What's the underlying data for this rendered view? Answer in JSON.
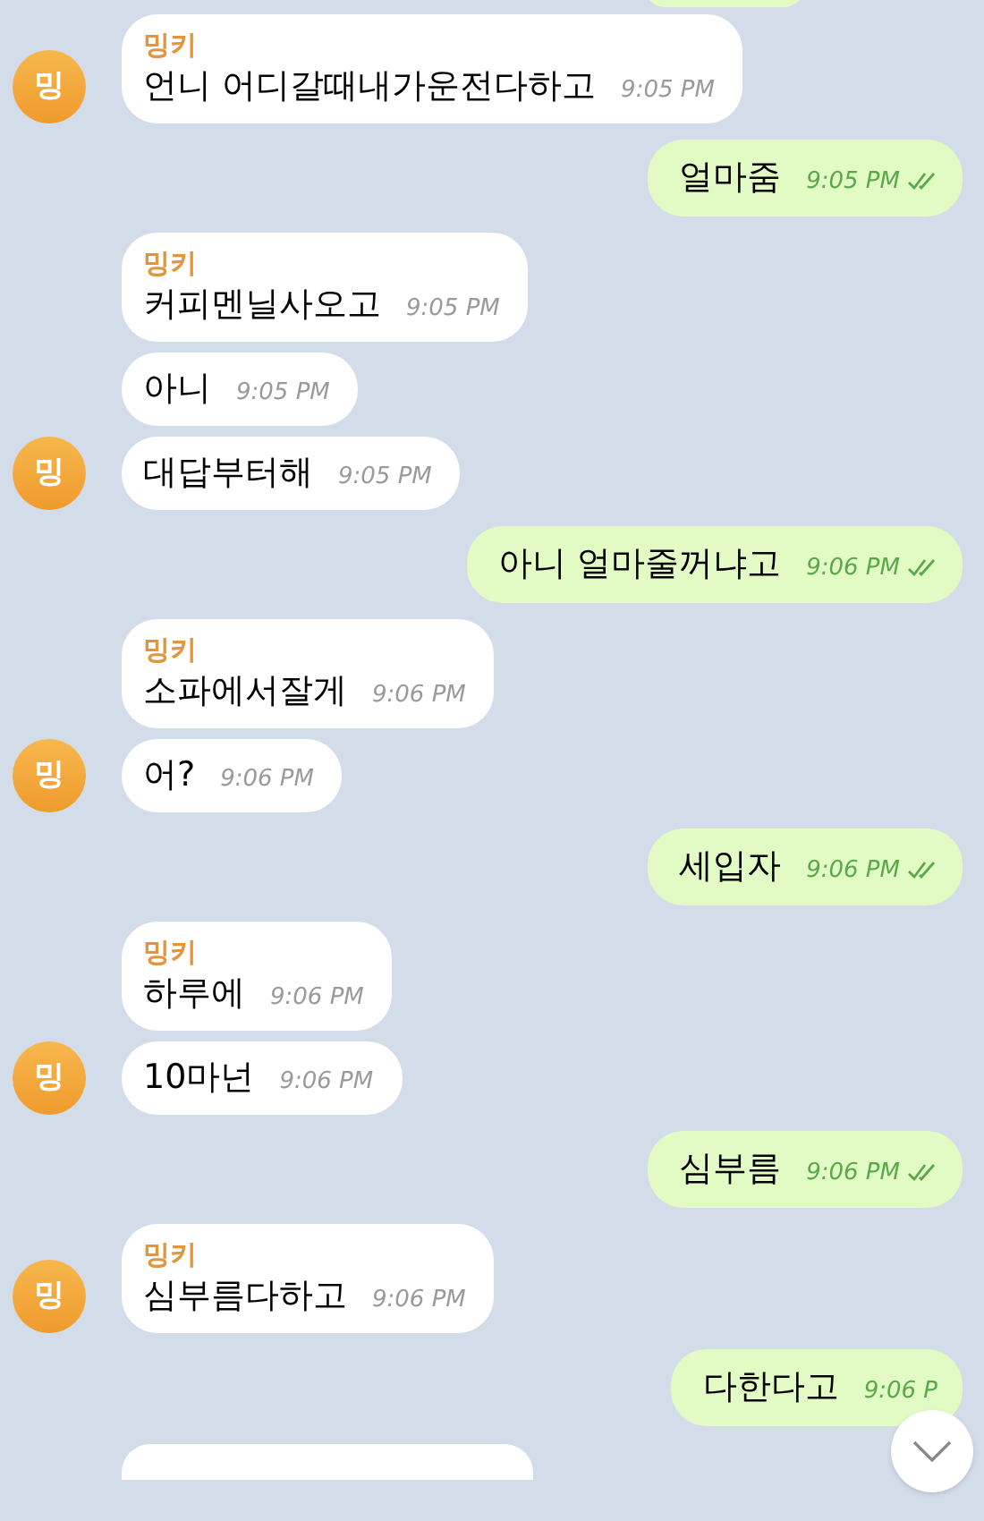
{
  "messages": [
    {
      "kind": "in",
      "sender": "밍키",
      "avatar": "밍",
      "text": "언니 어디갈때내가운전다하고",
      "time": "9:05 PM"
    },
    {
      "kind": "out",
      "text": "얼마줌",
      "time": "9:05 PM",
      "read": true
    },
    {
      "kind": "in",
      "sender": "밍키",
      "text": "커피멘닐사오고",
      "time": "9:05 PM"
    },
    {
      "kind": "in",
      "text": "아니",
      "time": "9:05 PM"
    },
    {
      "kind": "in",
      "avatar": "밍",
      "text": "대답부터해",
      "time": "9:05 PM"
    },
    {
      "kind": "out",
      "text": "아니 얼마줄꺼냐고",
      "time": "9:06 PM",
      "read": true
    },
    {
      "kind": "in",
      "sender": "밍키",
      "text": "소파에서잘게",
      "time": "9:06 PM"
    },
    {
      "kind": "in",
      "avatar": "밍",
      "text": "어?",
      "time": "9:06 PM"
    },
    {
      "kind": "out",
      "text": "세입자",
      "time": "9:06 PM",
      "read": true
    },
    {
      "kind": "in",
      "sender": "밍키",
      "text": "하루에",
      "time": "9:06 PM"
    },
    {
      "kind": "in",
      "avatar": "밍",
      "text": "10마넌",
      "time": "9:06 PM"
    },
    {
      "kind": "out",
      "text": "심부름",
      "time": "9:06 PM",
      "read": true
    },
    {
      "kind": "in",
      "sender": "밍키",
      "avatar": "밍",
      "text": "심부름다하고",
      "time": "9:06 PM"
    },
    {
      "kind": "out",
      "text": "다한다고",
      "time": "9:06 P",
      "read": false
    }
  ]
}
